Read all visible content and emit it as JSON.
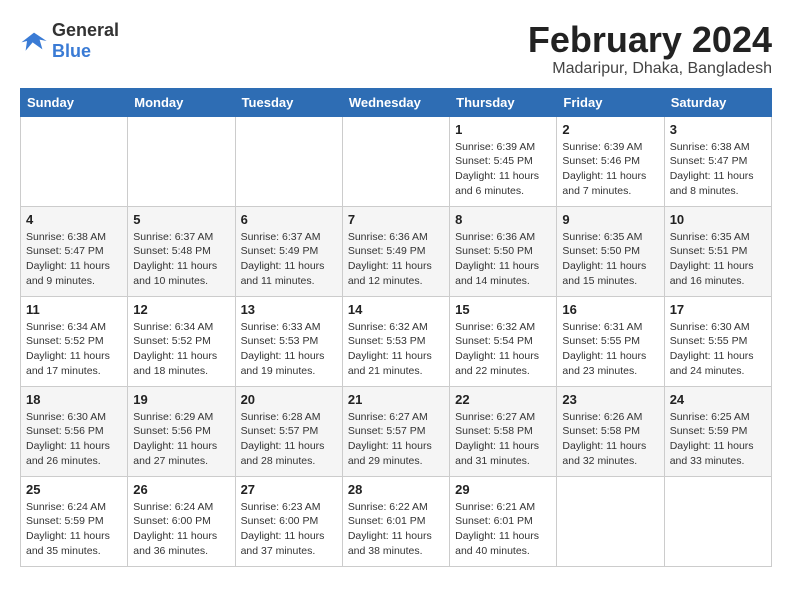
{
  "header": {
    "logo_general": "General",
    "logo_blue": "Blue",
    "month_year": "February 2024",
    "location": "Madaripur, Dhaka, Bangladesh"
  },
  "weekdays": [
    "Sunday",
    "Monday",
    "Tuesday",
    "Wednesday",
    "Thursday",
    "Friday",
    "Saturday"
  ],
  "weeks": [
    [
      {
        "day": "",
        "info": ""
      },
      {
        "day": "",
        "info": ""
      },
      {
        "day": "",
        "info": ""
      },
      {
        "day": "",
        "info": ""
      },
      {
        "day": "1",
        "info": "Sunrise: 6:39 AM\nSunset: 5:45 PM\nDaylight: 11 hours and 6 minutes."
      },
      {
        "day": "2",
        "info": "Sunrise: 6:39 AM\nSunset: 5:46 PM\nDaylight: 11 hours and 7 minutes."
      },
      {
        "day": "3",
        "info": "Sunrise: 6:38 AM\nSunset: 5:47 PM\nDaylight: 11 hours and 8 minutes."
      }
    ],
    [
      {
        "day": "4",
        "info": "Sunrise: 6:38 AM\nSunset: 5:47 PM\nDaylight: 11 hours and 9 minutes."
      },
      {
        "day": "5",
        "info": "Sunrise: 6:37 AM\nSunset: 5:48 PM\nDaylight: 11 hours and 10 minutes."
      },
      {
        "day": "6",
        "info": "Sunrise: 6:37 AM\nSunset: 5:49 PM\nDaylight: 11 hours and 11 minutes."
      },
      {
        "day": "7",
        "info": "Sunrise: 6:36 AM\nSunset: 5:49 PM\nDaylight: 11 hours and 12 minutes."
      },
      {
        "day": "8",
        "info": "Sunrise: 6:36 AM\nSunset: 5:50 PM\nDaylight: 11 hours and 14 minutes."
      },
      {
        "day": "9",
        "info": "Sunrise: 6:35 AM\nSunset: 5:50 PM\nDaylight: 11 hours and 15 minutes."
      },
      {
        "day": "10",
        "info": "Sunrise: 6:35 AM\nSunset: 5:51 PM\nDaylight: 11 hours and 16 minutes."
      }
    ],
    [
      {
        "day": "11",
        "info": "Sunrise: 6:34 AM\nSunset: 5:52 PM\nDaylight: 11 hours and 17 minutes."
      },
      {
        "day": "12",
        "info": "Sunrise: 6:34 AM\nSunset: 5:52 PM\nDaylight: 11 hours and 18 minutes."
      },
      {
        "day": "13",
        "info": "Sunrise: 6:33 AM\nSunset: 5:53 PM\nDaylight: 11 hours and 19 minutes."
      },
      {
        "day": "14",
        "info": "Sunrise: 6:32 AM\nSunset: 5:53 PM\nDaylight: 11 hours and 21 minutes."
      },
      {
        "day": "15",
        "info": "Sunrise: 6:32 AM\nSunset: 5:54 PM\nDaylight: 11 hours and 22 minutes."
      },
      {
        "day": "16",
        "info": "Sunrise: 6:31 AM\nSunset: 5:55 PM\nDaylight: 11 hours and 23 minutes."
      },
      {
        "day": "17",
        "info": "Sunrise: 6:30 AM\nSunset: 5:55 PM\nDaylight: 11 hours and 24 minutes."
      }
    ],
    [
      {
        "day": "18",
        "info": "Sunrise: 6:30 AM\nSunset: 5:56 PM\nDaylight: 11 hours and 26 minutes."
      },
      {
        "day": "19",
        "info": "Sunrise: 6:29 AM\nSunset: 5:56 PM\nDaylight: 11 hours and 27 minutes."
      },
      {
        "day": "20",
        "info": "Sunrise: 6:28 AM\nSunset: 5:57 PM\nDaylight: 11 hours and 28 minutes."
      },
      {
        "day": "21",
        "info": "Sunrise: 6:27 AM\nSunset: 5:57 PM\nDaylight: 11 hours and 29 minutes."
      },
      {
        "day": "22",
        "info": "Sunrise: 6:27 AM\nSunset: 5:58 PM\nDaylight: 11 hours and 31 minutes."
      },
      {
        "day": "23",
        "info": "Sunrise: 6:26 AM\nSunset: 5:58 PM\nDaylight: 11 hours and 32 minutes."
      },
      {
        "day": "24",
        "info": "Sunrise: 6:25 AM\nSunset: 5:59 PM\nDaylight: 11 hours and 33 minutes."
      }
    ],
    [
      {
        "day": "25",
        "info": "Sunrise: 6:24 AM\nSunset: 5:59 PM\nDaylight: 11 hours and 35 minutes."
      },
      {
        "day": "26",
        "info": "Sunrise: 6:24 AM\nSunset: 6:00 PM\nDaylight: 11 hours and 36 minutes."
      },
      {
        "day": "27",
        "info": "Sunrise: 6:23 AM\nSunset: 6:00 PM\nDaylight: 11 hours and 37 minutes."
      },
      {
        "day": "28",
        "info": "Sunrise: 6:22 AM\nSunset: 6:01 PM\nDaylight: 11 hours and 38 minutes."
      },
      {
        "day": "29",
        "info": "Sunrise: 6:21 AM\nSunset: 6:01 PM\nDaylight: 11 hours and 40 minutes."
      },
      {
        "day": "",
        "info": ""
      },
      {
        "day": "",
        "info": ""
      }
    ]
  ]
}
